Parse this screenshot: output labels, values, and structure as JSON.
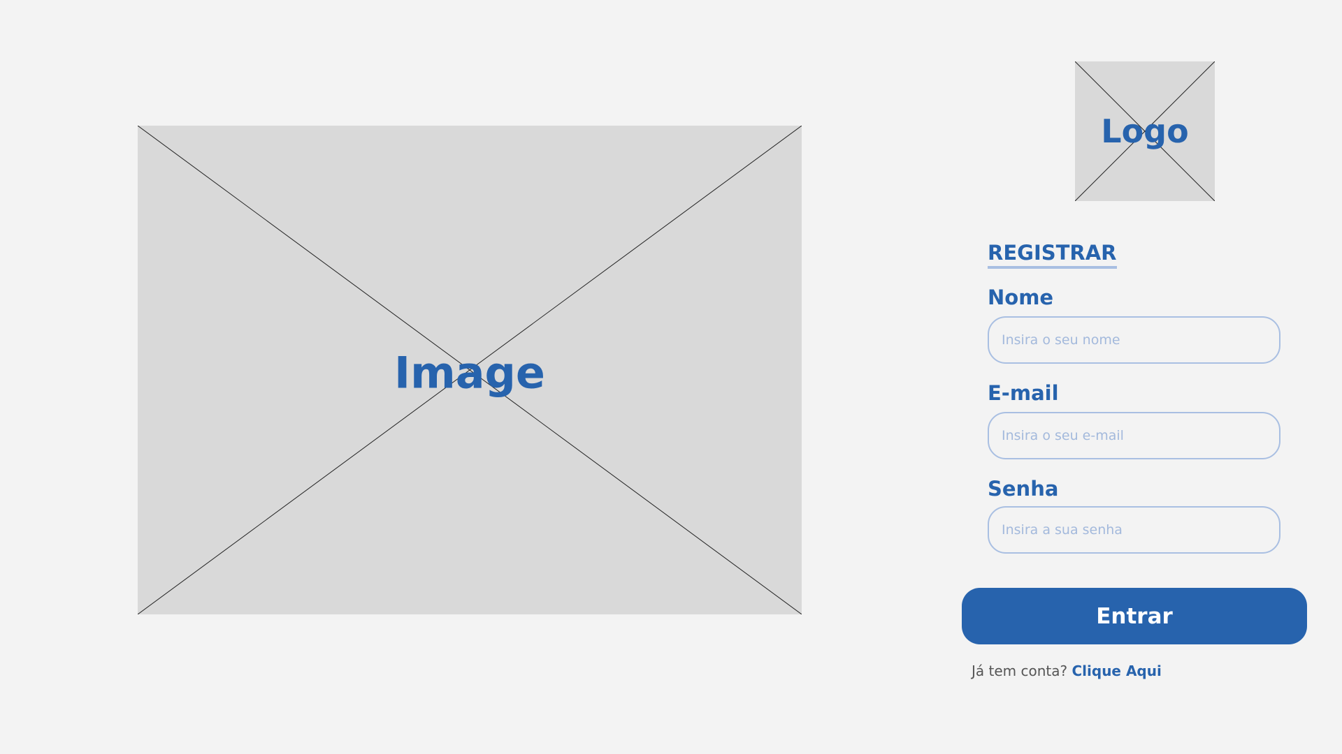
{
  "hero": {
    "placeholder_label": "Image"
  },
  "brand": {
    "logo_label": "Logo"
  },
  "form": {
    "heading": "REGISTRAR",
    "fields": {
      "name": {
        "label": "Nome",
        "placeholder": "Insira o seu nome",
        "value": ""
      },
      "email": {
        "label": "E-mail",
        "placeholder": "Insira o seu e-mail",
        "value": ""
      },
      "password": {
        "label": "Senha",
        "placeholder": "Insira a sua senha",
        "value": ""
      }
    },
    "submit_label": "Entrar",
    "login_prompt": {
      "text": "Já tem conta?",
      "link_label": "Clique Aqui"
    }
  },
  "colors": {
    "background": "#f3f3f3",
    "primary": "#2763ad",
    "placeholder_fill": "#d9d9d9",
    "input_border": "#a9bfe2"
  },
  "icons": {
    "hero": "image-placeholder-icon",
    "logo": "logo-placeholder-icon"
  }
}
